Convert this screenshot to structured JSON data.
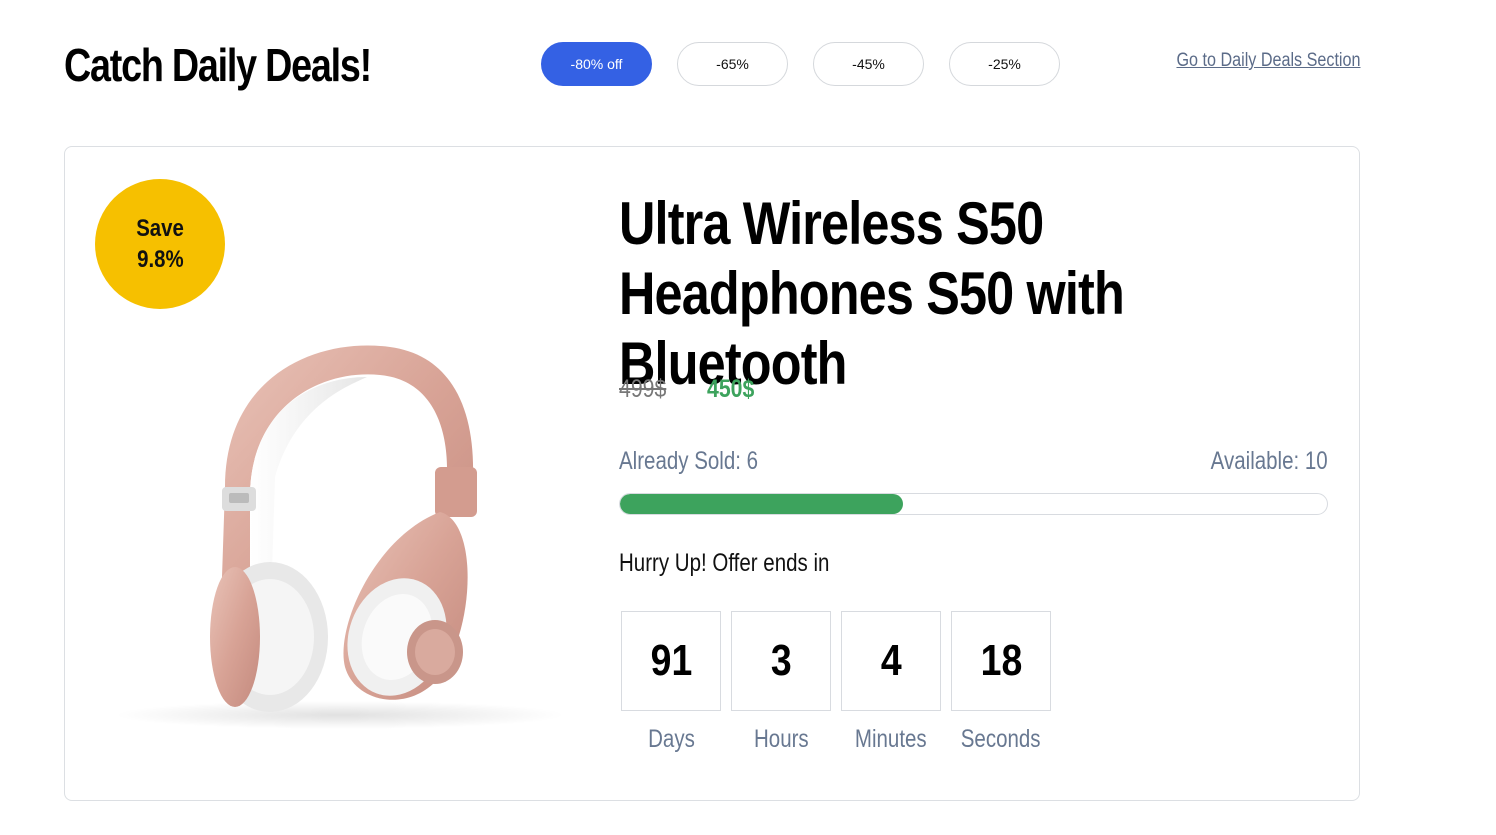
{
  "header": {
    "title": "Catch Daily Deals!",
    "filters": [
      {
        "label": "-80% off",
        "active": true
      },
      {
        "label": "-65%",
        "active": false
      },
      {
        "label": "-45%",
        "active": false
      },
      {
        "label": "-25%",
        "active": false
      }
    ],
    "section_link": "Go to Daily Deals Section"
  },
  "deal": {
    "badge_line1": "Save",
    "badge_line2": "9.8%",
    "product_image_icon": "headphones-image",
    "title": "Ultra Wireless S50 Headphones S50 with Bluetooth",
    "old_price": "499$",
    "new_price": "450$",
    "sold_label": "Already Sold: 6",
    "available_label": "Available: 10",
    "sold_fraction": 0.4,
    "hurry_text": "Hurry Up! Offer ends in",
    "countdown": [
      {
        "value": "91",
        "label": "Days"
      },
      {
        "value": "3",
        "label": "Hours"
      },
      {
        "value": "4",
        "label": "Minutes"
      },
      {
        "value": "18",
        "label": "Seconds"
      }
    ]
  },
  "colors": {
    "accent_blue": "#3461e4",
    "badge_yellow": "#f6c000",
    "price_green": "#3da35d",
    "muted_text": "#687891"
  }
}
